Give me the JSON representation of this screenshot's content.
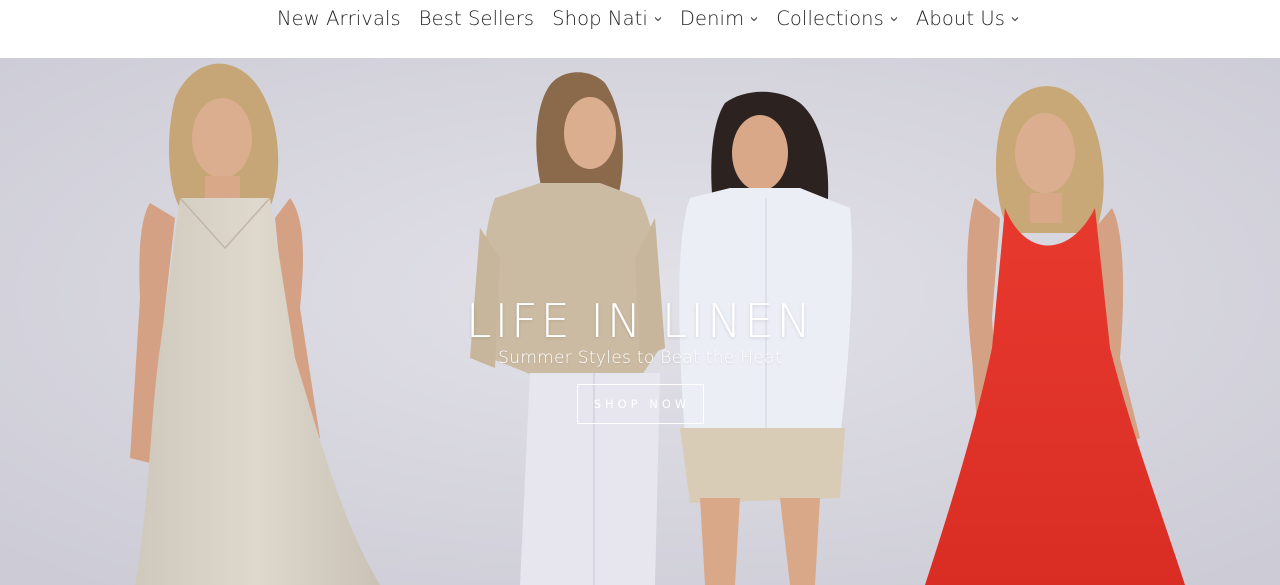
{
  "nav": {
    "items": [
      {
        "label": "New Arrivals",
        "has_dropdown": false
      },
      {
        "label": "Best Sellers",
        "has_dropdown": false
      },
      {
        "label": "Shop Nati",
        "has_dropdown": true
      },
      {
        "label": "Denim",
        "has_dropdown": true
      },
      {
        "label": "Collections",
        "has_dropdown": true
      },
      {
        "label": "About Us",
        "has_dropdown": true
      }
    ],
    "dropdown_icon": "chevron-down-icon"
  },
  "hero": {
    "title": "LIFE IN LINEN",
    "subtitle": "Summer Styles to Beat the Heat",
    "cta_label": "SHOP NOW",
    "image_description_colors": {
      "background": "#d8d7e0",
      "linen_dress": "#d9d3c7",
      "tan_shirt": "#cdbba3",
      "white_shirt": "#eceef6",
      "shorts": "#d8ccb6",
      "red_dress": "#e3352b",
      "skin": "#d9a889",
      "hair_blonde": "#c9a878",
      "hair_brown": "#7a5a3f",
      "hair_dark": "#2c2320"
    }
  }
}
